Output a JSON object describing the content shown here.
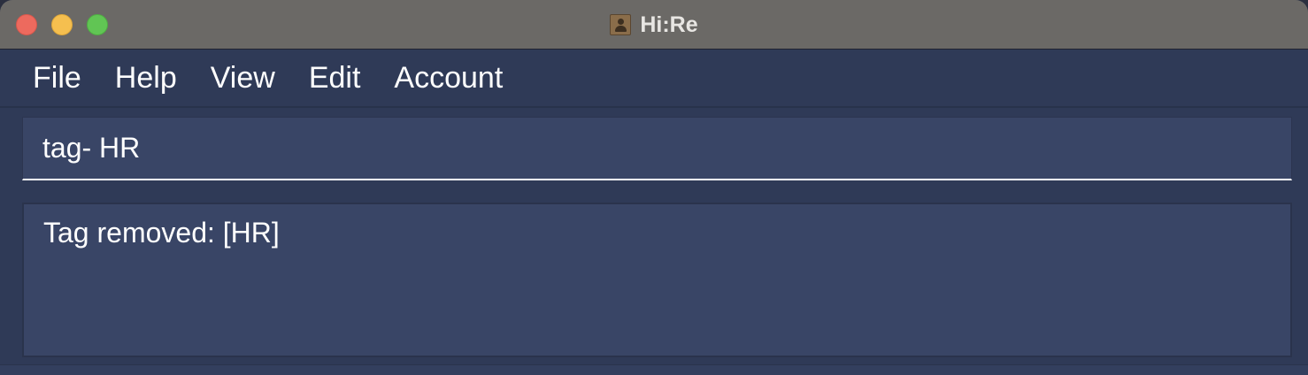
{
  "window": {
    "title": "Hi:Re",
    "icon": "contact-book-icon"
  },
  "menubar": {
    "items": [
      {
        "label": "File"
      },
      {
        "label": "Help"
      },
      {
        "label": "View"
      },
      {
        "label": "Edit"
      },
      {
        "label": "Account"
      }
    ]
  },
  "command": {
    "value": "tag- HR",
    "placeholder": ""
  },
  "result": {
    "message": "Tag removed: [HR]"
  },
  "colors": {
    "background": "#2f3a57",
    "panel": "#394566",
    "text": "#ffffff",
    "titlebar": "#6b6966"
  }
}
